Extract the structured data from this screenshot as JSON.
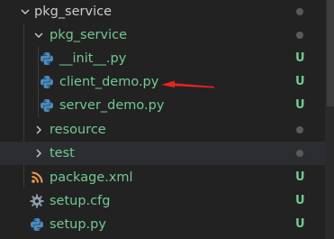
{
  "colors": {
    "background": "#222222",
    "folder_text": "#cccccc",
    "untracked_text": "#73c991",
    "badge_untracked": "#73c991",
    "dot": "#5a5a5a",
    "python_blue": "#4b8bbe",
    "python_yellow": "#ffd43b",
    "rss_orange": "#f39c4a",
    "gear_gray": "#8a9aa9",
    "arrow_red": "#e8231f"
  },
  "tree": {
    "folder_root": {
      "label": "pkg_service",
      "icon": "chevron-down-icon",
      "status": "dot"
    },
    "folder_sub": {
      "label": "pkg_service",
      "icon": "chevron-down-icon",
      "status": "dot"
    },
    "file_init": {
      "label": "__init__.py",
      "icon": "python-icon",
      "badge": "U"
    },
    "file_client": {
      "label": "client_demo.py",
      "icon": "python-icon",
      "badge": "U"
    },
    "file_server": {
      "label": "server_demo.py",
      "icon": "python-icon",
      "badge": "U"
    },
    "folder_resource": {
      "label": "resource",
      "icon": "chevron-right-icon",
      "status": "dot"
    },
    "folder_test": {
      "label": "test",
      "icon": "chevron-right-icon",
      "status": "dot"
    },
    "file_package": {
      "label": "package.xml",
      "icon": "rss-icon",
      "badge": "U"
    },
    "file_setupcfg": {
      "label": "setup.cfg",
      "icon": "gear-icon",
      "badge": "U"
    },
    "file_setuppy": {
      "label": "setup.py",
      "icon": "python-icon",
      "badge": "U"
    }
  },
  "annotation": {
    "icon": "red-arrow-icon"
  }
}
